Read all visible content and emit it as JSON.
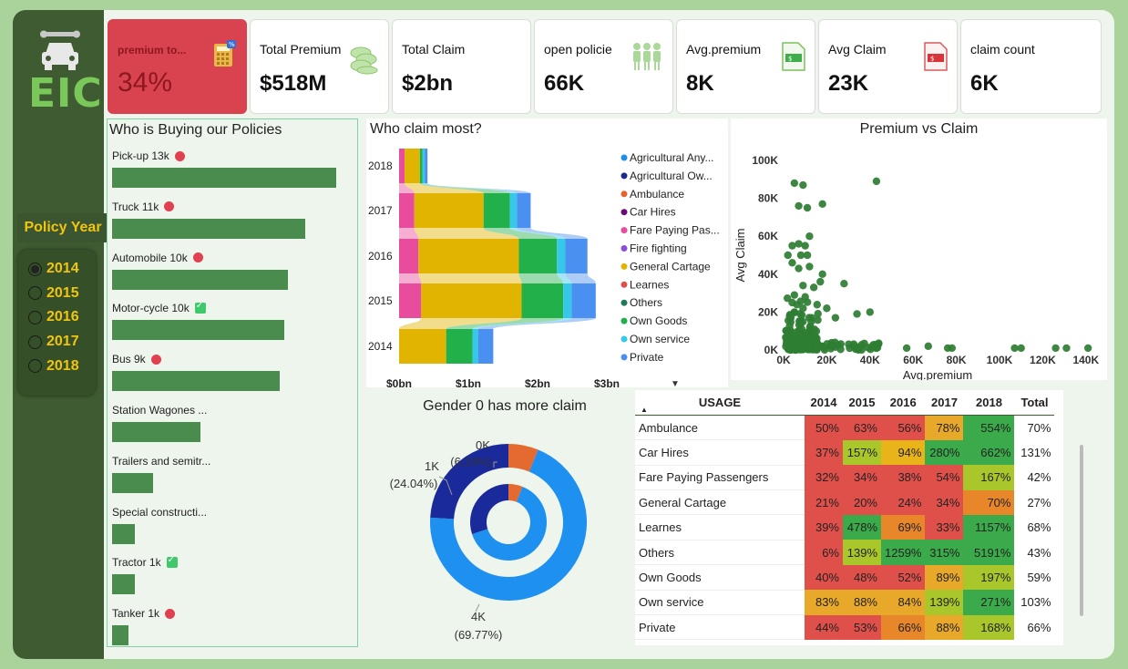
{
  "sidebar": {
    "logo_text": "EIC",
    "policy_year_title": "Policy Year",
    "years": [
      "2014",
      "2015",
      "2016",
      "2017",
      "2018"
    ],
    "selected_year": "2014"
  },
  "kpis": [
    {
      "label": "premium to...",
      "value": "34%",
      "icon": "calculator-icon"
    },
    {
      "label": "Total Premium",
      "value": "$518M",
      "icon": "coins-icon"
    },
    {
      "label": "Total Claim",
      "value": "$2bn",
      "icon": ""
    },
    {
      "label": "open policie",
      "value": "66K",
      "icon": "people-icon"
    },
    {
      "label": "Avg.premium",
      "value": "8K",
      "icon": "dollar-doc-icon"
    },
    {
      "label": "Avg Claim",
      "value": "23K",
      "icon": "dollar-doc-red-icon"
    },
    {
      "label": "claim count",
      "value": "6K",
      "icon": ""
    }
  ],
  "buyers": {
    "title": "Who is Buying our Policies",
    "items": [
      {
        "label": "Pick-up 13k",
        "mark": "red",
        "value": 13
      },
      {
        "label": "Truck 11k",
        "mark": "red",
        "value": 11.2
      },
      {
        "label": "Automobile 10k",
        "mark": "red",
        "value": 10.2
      },
      {
        "label": "Motor-cycle 10k",
        "mark": "check",
        "value": 10
      },
      {
        "label": "Bus 9k",
        "mark": "red",
        "value": 9.7
      },
      {
        "label": "Station Wagones ...",
        "mark": "",
        "value": 5.1
      },
      {
        "label": "Trailers and semitr...",
        "mark": "",
        "value": 2.4
      },
      {
        "label": "Special constructi...",
        "mark": "",
        "value": 1.3
      },
      {
        "label": "Tractor 1k",
        "mark": "check",
        "value": 1.3
      },
      {
        "label": "Tanker 1k",
        "mark": "red",
        "value": 0.8
      }
    ]
  },
  "claim_most": {
    "title": "Who claim most?",
    "years": [
      "2018",
      "2017",
      "2016",
      "2015",
      "2014"
    ],
    "x_ticks": [
      "$0bn",
      "$1bn",
      "$2bn",
      "$3bn"
    ],
    "legend": [
      {
        "name": "Agricultural Any...",
        "color": "#1e90e6"
      },
      {
        "name": "Agricultural Ow...",
        "color": "#1a2a8c"
      },
      {
        "name": "Ambulance",
        "color": "#e8622a"
      },
      {
        "name": "Car Hires",
        "color": "#6a0a7a"
      },
      {
        "name": "Fare Paying Pas...",
        "color": "#e84c9c"
      },
      {
        "name": "Fire fighting",
        "color": "#8a4ed8"
      },
      {
        "name": "General Cartage",
        "color": "#e0b400"
      },
      {
        "name": "Learnes",
        "color": "#e0504a"
      },
      {
        "name": "Others",
        "color": "#1f7a5a"
      },
      {
        "name": "Own Goods",
        "color": "#22b04a"
      },
      {
        "name": "Own service",
        "color": "#36c8e8"
      },
      {
        "name": "Private",
        "color": "#4a90f0"
      }
    ]
  },
  "pvc": {
    "title": "Premium vs Claim",
    "xlabel": "Avg.premium",
    "ylabel": "Avg Claim",
    "x_ticks": [
      "0K",
      "20K",
      "40K",
      "60K",
      "80K",
      "100K",
      "120K",
      "140K"
    ],
    "y_ticks": [
      "0K",
      "20K",
      "40K",
      "60K",
      "80K",
      "100K"
    ]
  },
  "gender": {
    "title": "Gender 0 has more claim",
    "labels": [
      {
        "value": "0K",
        "pct": "(6.19%)"
      },
      {
        "value": "1K",
        "pct": "(24.04%)"
      },
      {
        "value": "4K",
        "pct": "(69.77%)"
      }
    ]
  },
  "matrix": {
    "headers": [
      "USAGE",
      "2014",
      "2015",
      "2016",
      "2017",
      "2018",
      "Total"
    ],
    "rows": [
      {
        "name": "Ambulance",
        "vals": [
          "50%",
          "63%",
          "56%",
          "78%",
          "554%"
        ],
        "total": "70%"
      },
      {
        "name": "Car Hires",
        "vals": [
          "37%",
          "157%",
          "94%",
          "280%",
          "662%"
        ],
        "total": "131%"
      },
      {
        "name": "Fare Paying Passengers",
        "vals": [
          "32%",
          "34%",
          "38%",
          "54%",
          "167%"
        ],
        "total": "42%"
      },
      {
        "name": "General Cartage",
        "vals": [
          "21%",
          "20%",
          "24%",
          "34%",
          "70%"
        ],
        "total": "27%"
      },
      {
        "name": "Learnes",
        "vals": [
          "39%",
          "478%",
          "69%",
          "33%",
          "1157%"
        ],
        "total": "68%"
      },
      {
        "name": "Others",
        "vals": [
          "6%",
          "139%",
          "1259%",
          "315%",
          "5191%"
        ],
        "total": "43%"
      },
      {
        "name": "Own Goods",
        "vals": [
          "40%",
          "48%",
          "52%",
          "89%",
          "197%"
        ],
        "total": "59%"
      },
      {
        "name": "Own service",
        "vals": [
          "83%",
          "88%",
          "84%",
          "139%",
          "271%"
        ],
        "total": "103%"
      },
      {
        "name": "Private",
        "vals": [
          "44%",
          "53%",
          "66%",
          "88%",
          "168%"
        ],
        "total": "66%"
      }
    ],
    "colors": [
      [
        "#e0504a",
        "#e0504a",
        "#e0504a",
        "#e8a92a",
        "#3aaa4a"
      ],
      [
        "#e0504a",
        "#a9c62a",
        "#e8b41a",
        "#3aaa4a",
        "#3aaa4a"
      ],
      [
        "#e0504a",
        "#e0504a",
        "#e0504a",
        "#e0504a",
        "#a9c62a"
      ],
      [
        "#e0504a",
        "#e0504a",
        "#e0504a",
        "#e0504a",
        "#e8862a"
      ],
      [
        "#e0504a",
        "#3aaa4a",
        "#e8862a",
        "#e0504a",
        "#3aaa4a"
      ],
      [
        "#e0504a",
        "#a9c62a",
        "#3aaa4a",
        "#3aaa4a",
        "#3aaa4a"
      ],
      [
        "#e0504a",
        "#e0504a",
        "#e0504a",
        "#e8a92a",
        "#a9c62a"
      ],
      [
        "#e8a92a",
        "#e8a92a",
        "#e8a92a",
        "#a9c62a",
        "#3aaa4a"
      ],
      [
        "#e0504a",
        "#e0504a",
        "#e8862a",
        "#e8a92a",
        "#a9c62a"
      ]
    ]
  }
}
